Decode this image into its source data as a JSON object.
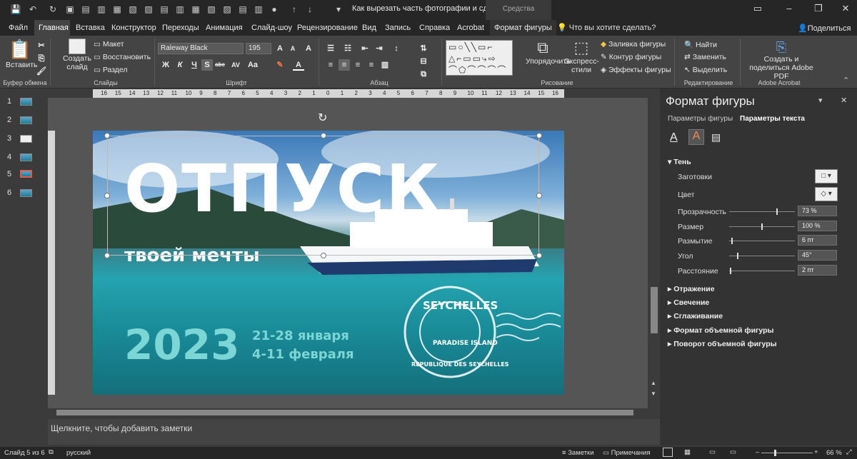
{
  "titlebar": {
    "doc_title": "Как вырезать часть фотографии и сдела...",
    "context_header": "Средства рисования"
  },
  "tabs": [
    "Файл",
    "Главная",
    "Вставка",
    "Конструктор",
    "Переходы",
    "Анимация",
    "Слайд-шоу",
    "Рецензирование",
    "Вид",
    "Запись",
    "Справка",
    "Acrobat",
    "Формат фигуры"
  ],
  "tell_me": "Что вы хотите сделать?",
  "share": "Поделиться",
  "ribbon": {
    "paste": "Вставить",
    "clipboard": "Буфер обмена",
    "new_slide": "Создать слайд",
    "layout": "Макет",
    "reset": "Восстановить",
    "section": "Раздел",
    "slides": "Слайды",
    "font_name": "Raleway Black",
    "font_size": "195",
    "font": "Шрифт",
    "paragraph": "Абзац",
    "arrange": "Упорядочить",
    "quick_styles": "Экспресс-стили",
    "shape_fill": "Заливка фигуры",
    "shape_outline": "Контур фигуры",
    "shape_effects": "Эффекты фигуры",
    "drawing": "Рисование",
    "find": "Найти",
    "replace": "Заменить",
    "select": "Выделить",
    "editing": "Редактирование",
    "adobe": "Создать и поделиться Adobe PDF",
    "acrobat": "Adobe Acrobat"
  },
  "slides": [
    "1",
    "2",
    "3",
    "4",
    "5",
    "6"
  ],
  "ruler_h": [
    "16",
    "15",
    "14",
    "13",
    "12",
    "11",
    "10",
    "9",
    "8",
    "7",
    "6",
    "5",
    "4",
    "3",
    "2",
    "1",
    "0",
    "1",
    "2",
    "3",
    "4",
    "5",
    "6",
    "7",
    "8",
    "9",
    "10",
    "11",
    "12",
    "13",
    "14",
    "15",
    "16"
  ],
  "slide": {
    "headline": "ОТПУСК",
    "subline": "твоей мечты",
    "year": "2023",
    "date1": "21-28 января",
    "date2": "4-11 февраля",
    "stamp_top": "SEYCHELLES",
    "stamp_mid": "PARADISE ISLAND",
    "stamp_bottom": "REPUBLIQUE DES SEYCHELLES"
  },
  "notes": "Щелкните, чтобы добавить заметки",
  "pane": {
    "title": "Формат фигуры",
    "tab1": "Параметры фигуры",
    "tab2": "Параметры текста",
    "shadow": "Тень",
    "presets": "Заготовки",
    "color": "Цвет",
    "transparency": "Прозрачность",
    "transparency_val": "73 %",
    "size": "Размер",
    "size_val": "100 %",
    "blur": "Размытие",
    "blur_val": "6 пт",
    "angle": "Угол",
    "angle_val": "45°",
    "distance": "Расстояние",
    "distance_val": "2 пт",
    "reflection": "Отражение",
    "glow": "Свечение",
    "smoothing": "Сглаживание",
    "format3d": "Формат объемной фигуры",
    "rotate3d": "Поворот объемной фигуры"
  },
  "status": {
    "slide_of": "Слайд 5 из 6",
    "language": "русский",
    "notes": "Заметки",
    "comments": "Примечания",
    "zoom": "66 %"
  }
}
